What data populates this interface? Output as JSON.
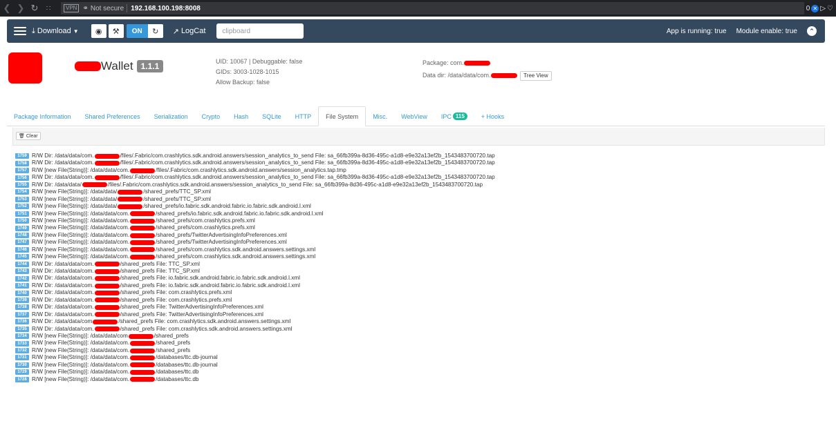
{
  "browser": {
    "vpn_label": "VPN",
    "security": "Not secure",
    "url": "192.168.100.198:8008",
    "right_text": "0"
  },
  "navbar": {
    "download_label": "Download",
    "on_label": "ON",
    "logcat_label": "LogCat",
    "clipboard_placeholder": "clipboard",
    "app_running": "App is running: true",
    "module_enable": "Module enable: true"
  },
  "app": {
    "name_suffix": "Wallet",
    "version": "1.1.1",
    "uid_line": "UID: 10067 | Debuggable: false",
    "gids_line": "GIDs: 3003-1028-1015",
    "backup_line": "Allow Backup: false",
    "package_label": "Package: com.",
    "data_dir_label": "Data dir: /data/data/com.",
    "tree_view_label": "Tree View"
  },
  "tabs": [
    {
      "label": "Package Information"
    },
    {
      "label": "Shared Preferences"
    },
    {
      "label": "Serialization"
    },
    {
      "label": "Crypto"
    },
    {
      "label": "Hash"
    },
    {
      "label": "SQLite"
    },
    {
      "label": "HTTP"
    },
    {
      "label": "File System"
    },
    {
      "label": "Misc."
    },
    {
      "label": "WebView"
    },
    {
      "label": "IPC",
      "badge": "115"
    },
    {
      "label": "+ Hooks"
    }
  ],
  "toolbar": {
    "clear_label": "Clear"
  },
  "log": [
    {
      "n": "1759",
      "a": "R/W Dir: /data/data/com.",
      "b": "/files/.Fabric/com.crashlytics.sdk.android.answers/session_analytics_to_send File: sa_66fb399a-8d36-495c-a1d8-e9e32a13ef2b_1543483700720.tap"
    },
    {
      "n": "1758",
      "a": "R/W Dir: /data/data/com.",
      "b": "/files/.Fabric/com.crashlytics.sdk.android.answers/session_analytics_to_send File: sa_66fb399a-8d36-495c-a1d8-e9e32a13ef2b_1543483700720.tap"
    },
    {
      "n": "1757",
      "a": "R/W [new File(String)]: /data/data/com.",
      "b": "/files/.Fabric/com.crashlytics.sdk.android.answers/session_analytics.tap.tmp"
    },
    {
      "n": "1756",
      "a": "R/W Dir: /data/data/com.",
      "b": "/files/.Fabric/com.crashlytics.sdk.android.answers/session_analytics_to_send File: sa_66fb399a-8d36-495c-a1d8-e9e32a13ef2b_1543483700720.tap"
    },
    {
      "n": "1755",
      "a": "R/W Dir: /data/data/",
      "b": "/files/.Fabric/com.crashlytics.sdk.android.answers/session_analytics_to_send File: sa_66fb399a-8d36-495c-a1d8-e9e32a13ef2b_1543483700720.tap"
    },
    {
      "n": "1754",
      "a": "R/W [new File(String)]: /data/data/",
      "b": "/shared_prefs/TTC_SP.xml"
    },
    {
      "n": "1753",
      "a": "R/W [new File(String)]: /data/data/",
      "b": "/shared_prefs/TTC_SP.xml"
    },
    {
      "n": "1752",
      "a": "R/W [new File(String)]: /data/data/",
      "b": "/shared_prefs/io.fabric.sdk.android.fabric.io.fabric.sdk.android.l.xml"
    },
    {
      "n": "1751",
      "a": "R/W [new File(String)]: /data/data/com.",
      "b": "/shared_prefs/io.fabric.sdk.android.fabric.io.fabric.sdk.android.l.xml"
    },
    {
      "n": "1750",
      "a": "R/W [new File(String)]: /data/data/com.",
      "b": "/shared_prefs/com.crashlytics.prefs.xml"
    },
    {
      "n": "1749",
      "a": "R/W [new File(String)]: /data/data/com.",
      "b": "/shared_prefs/com.crashlytics.prefs.xml"
    },
    {
      "n": "1748",
      "a": "R/W [new File(String)]: /data/data/com.",
      "b": "/shared_prefs/TwitterAdvertisingInfoPreferences.xml"
    },
    {
      "n": "1747",
      "a": "R/W [new File(String)]: /data/data/com.",
      "b": "/shared_prefs/TwitterAdvertisingInfoPreferences.xml"
    },
    {
      "n": "1746",
      "a": "R/W [new File(String)]: /data/data/com.",
      "b": "/shared_prefs/com.crashlytics.sdk.android.answers.settings.xml"
    },
    {
      "n": "1745",
      "a": "R/W [new File(String)]: /data/data/com.",
      "b": "/shared_prefs/com.crashlytics.sdk.android.answers.settings.xml"
    },
    {
      "n": "1744",
      "a": "R/W Dir: /data/data/com.",
      "b": "/shared_prefs File: TTC_SP.xml"
    },
    {
      "n": "1743",
      "a": "R/W Dir: /data/data/com.",
      "b": "/shared_prefs File: TTC_SP.xml"
    },
    {
      "n": "1742",
      "a": "R/W Dir: /data/data/com.",
      "b": "/shared_prefs File: io.fabric.sdk.android.fabric.io.fabric.sdk.android.l.xml"
    },
    {
      "n": "1741",
      "a": "R/W Dir: /data/data/com.",
      "b": "/shared_prefs File: io.fabric.sdk.android.fabric.io.fabric.sdk.android.l.xml"
    },
    {
      "n": "1740",
      "a": "R/W Dir: /data/data/com.",
      "b": "/shared_prefs File: com.crashlytics.prefs.xml"
    },
    {
      "n": "1739",
      "a": "R/W Dir: /data/data/com.",
      "b": "/shared_prefs File: com.crashlytics.prefs.xml"
    },
    {
      "n": "1738",
      "a": "R/W Dir: /data/data/com.",
      "b": "/shared_prefs File: TwitterAdvertisingInfoPreferences.xml"
    },
    {
      "n": "1737",
      "a": "R/W Dir: /data/data/com.",
      "b": "/shared_prefs File: TwitterAdvertisingInfoPreferences.xml"
    },
    {
      "n": "1736",
      "a": "R/W Dir: /data/data/com",
      "b": "/shared_prefs File: com.crashlytics.sdk.android.answers.settings.xml"
    },
    {
      "n": "1735",
      "a": "R/W Dir: /data/data/com.",
      "b": "/shared_prefs File: com.crashlytics.sdk.android.answers.settings.xml"
    },
    {
      "n": "1734",
      "a": "R/W [new File(String)]: /data/data/com",
      "b": "/shared_prefs"
    },
    {
      "n": "1733",
      "a": "R/W [new File(String)]: /data/data/com.",
      "b": "/shared_prefs"
    },
    {
      "n": "1732",
      "a": "R/W [new File(String)]: /data/data/com.",
      "b": "/shared_prefs"
    },
    {
      "n": "1731",
      "a": "R/W [new File(String)]: /data/data/com.",
      "b": "/databases/ttc.db-journal"
    },
    {
      "n": "1730",
      "a": "R/W [new File(String)]: /data/data/com.",
      "b": "/databases/ttc.db-journal"
    },
    {
      "n": "1729",
      "a": "R/W [new File(String)]: /data/data/com.",
      "b": "/databases/ttc.db"
    },
    {
      "n": "1728",
      "a": "R/W [new File(String)]: /data/data/com.",
      "b": "/databases/ttc.db"
    }
  ]
}
